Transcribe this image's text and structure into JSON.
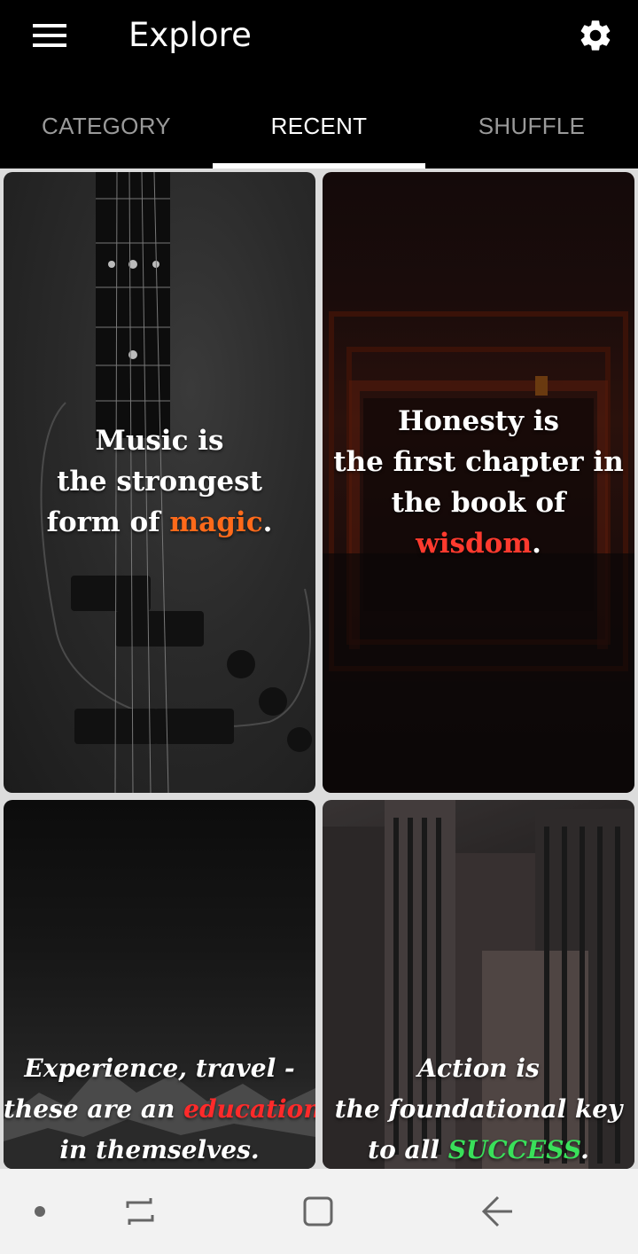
{
  "app_bar": {
    "title": "Explore",
    "menu_icon": "hamburger-menu-icon",
    "settings_icon": "gear-icon"
  },
  "tabs": [
    {
      "label": "CATEGORY",
      "active": false
    },
    {
      "label": "RECENT",
      "active": true
    },
    {
      "label": "SHUFFLE",
      "active": false
    }
  ],
  "cards": [
    {
      "image": "bass-guitar-photo",
      "lines": [
        "Music is",
        "the strongest"
      ],
      "last_prefix": "form of ",
      "highlight": "magic",
      "suffix": ".",
      "highlight_color": "#ff6a1a"
    },
    {
      "image": "red-torii-corridor-photo",
      "lines": [
        "Honesty is",
        "the first chapter in",
        "the book of"
      ],
      "last_prefix": "",
      "highlight": "wisdom",
      "suffix": ".",
      "highlight_color": "#ff3a2e"
    },
    {
      "image": "dark-mountain-photo",
      "lines": [
        "Experience, travel -"
      ],
      "last_prefix": "these are an ",
      "highlight": "education",
      "after_highlight_line": "in themselves.",
      "suffix": "",
      "highlight_color": "#ff2a2a"
    },
    {
      "image": "city-skyscrapers-photo",
      "lines": [
        "Action is",
        "the foundational key"
      ],
      "last_prefix": "to all ",
      "highlight": "SUCCESS",
      "suffix": ".",
      "highlight_color": "#39e05a"
    }
  ],
  "navbar": {
    "dot_icon": "dot-icon",
    "recents_icon": "recent-apps-icon",
    "home_icon": "home-icon",
    "back_icon": "back-arrow-icon"
  },
  "colors": {
    "app_bar_bg": "#000000",
    "tab_inactive": "#9a9a9a",
    "tab_active": "#ffffff",
    "navbar_bg": "#f2f2f2"
  }
}
